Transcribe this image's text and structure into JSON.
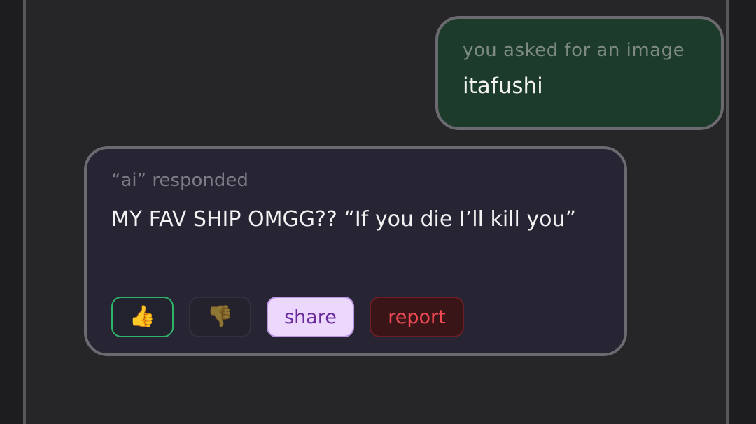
{
  "user_message": {
    "label": "you asked for an image",
    "text": "itafushi"
  },
  "ai_message": {
    "label": "“ai” responded",
    "text": "MY FAV SHIP OMGG?? “If you die I’ll kill you”"
  },
  "actions": {
    "like_icon": "👍",
    "dislike_icon": "👎",
    "share_label": "share",
    "report_label": "report"
  },
  "colors": {
    "user_bubble_bg": "#1c3b2a",
    "ai_bubble_bg": "#272434",
    "like_border": "#2fb26a",
    "share_bg": "#ecd7fd",
    "report_text": "#ef4a54"
  }
}
